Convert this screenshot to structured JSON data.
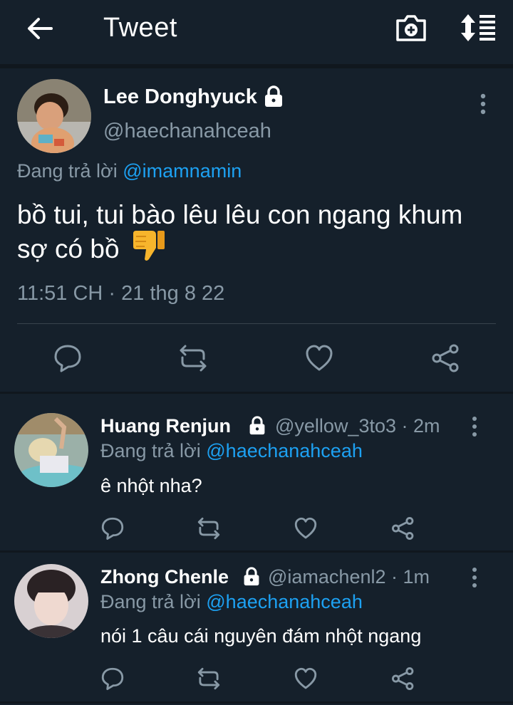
{
  "header": {
    "title": "Tweet",
    "icons": [
      "back-arrow-icon",
      "camera-add-icon",
      "sort-icon"
    ]
  },
  "main_tweet": {
    "name": "Lee Donghyuck",
    "handle": "@haechanahceah",
    "reply_prefix": "Đang trả lời ",
    "reply_mention": "@imamnamin",
    "text_line1": "bồ tui, tui bào lêu lêu con ngang khum",
    "text_line2": "sợ có bồ",
    "emoji": "thumbs-down",
    "timestamp": "11:51 CH · 21 thg 8 22",
    "actions": [
      "reply-icon",
      "retweet-icon",
      "like-icon",
      "share-icon"
    ]
  },
  "replies": [
    {
      "name": "Huang Renjun",
      "handle": "@yellow_3to3 · 2m",
      "reply_prefix": "Đang trả lời ",
      "reply_mention": "@haechanahceah",
      "text": "ê nhột nha?"
    },
    {
      "name": "Zhong Chenle",
      "handle": "@iamachenl2 · 1m",
      "reply_prefix": "Đang trả lời ",
      "reply_mention": "@haechanahceah",
      "text": "nói 1 câu cái nguyên đám nhột ngang"
    }
  ],
  "colors": {
    "background": "#15202b",
    "text": "#ffffff",
    "secondary": "#8899a6",
    "accent": "#1da1f2",
    "divider": "#38444d"
  }
}
